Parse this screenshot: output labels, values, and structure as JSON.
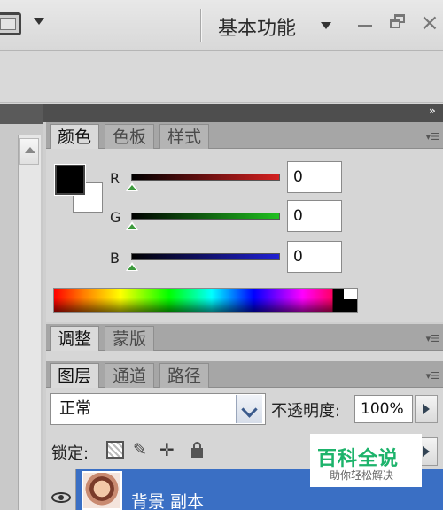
{
  "topbar": {
    "screen_mode_icon": "screen-mode-icon",
    "workspace_label": "基本功能",
    "minimize_icon": "minimize-icon",
    "restore_icon": "restore-icon",
    "close_label": "×"
  },
  "dock": {
    "collapse_label": "»"
  },
  "color_panel": {
    "tabs": [
      {
        "label": "颜色",
        "active": true
      },
      {
        "label": "色板",
        "active": false
      },
      {
        "label": "样式",
        "active": false
      }
    ],
    "foreground_color": "#000000",
    "background_color": "#ffffff",
    "channels": [
      {
        "label": "R",
        "value": "0",
        "color": "#d42020"
      },
      {
        "label": "G",
        "value": "0",
        "color": "#20c020"
      },
      {
        "label": "B",
        "value": "0",
        "color": "#2020d4"
      }
    ]
  },
  "adjust_panel": {
    "tabs": [
      {
        "label": "调整",
        "active": true
      },
      {
        "label": "蒙版",
        "active": false
      }
    ]
  },
  "layers_panel": {
    "tabs": [
      {
        "label": "图层",
        "active": true
      },
      {
        "label": "通道",
        "active": false
      },
      {
        "label": "路径",
        "active": false
      }
    ],
    "blend_mode": "正常",
    "opacity_label": "不透明度:",
    "opacity_value": "100%",
    "lock_label": "锁定:",
    "lock_brush_glyph": "✎",
    "lock_move_glyph": "✛",
    "layers": [
      {
        "name": "背景 副本",
        "selected": true
      }
    ]
  },
  "watermark": {
    "title": "百科全说",
    "subtitle": "助你轻松解决"
  },
  "accent_colors": {
    "selection_blue": "#3a6fc4",
    "watermark_green": "#1db36b"
  }
}
